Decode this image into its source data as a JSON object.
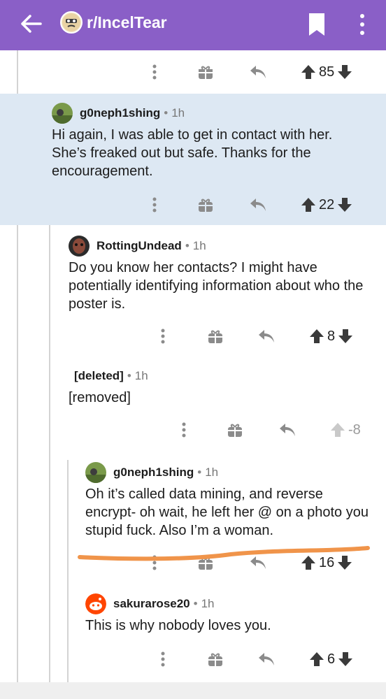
{
  "header": {
    "subreddit": "r/IncelTear"
  },
  "colors": {
    "accent": "#8a5fc7",
    "highlight": "#dde8f3",
    "annotation": "#f0944a"
  },
  "icons": [
    "back-arrow-icon",
    "subreddit-avatar-icon",
    "bookmark-icon",
    "more-vertical-icon",
    "more-dots-icon",
    "gift-icon",
    "reply-icon",
    "upvote-icon",
    "downvote-icon"
  ],
  "comments": [
    {
      "score": "85"
    },
    {
      "user": "g0neph1shing",
      "time": "1h",
      "body": "Hi again, I was able to get in contact with her. She’s freaked out but safe. Thanks for the encouragement.",
      "score": "22"
    },
    {
      "user": "RottingUndead",
      "time": "1h",
      "body": "Do you know her contacts? I might have potentially identifying information about who the poster is.",
      "score": "8"
    },
    {
      "user": "[deleted]",
      "time": "1h",
      "body": "[removed]",
      "score": "-8"
    },
    {
      "user": "g0neph1shing",
      "time": "1h",
      "body": "Oh it’s called data mining, and reverse encrypt- oh wait, he left her @ on a photo you stupid fuck. Also I’m a woman.",
      "score": "16"
    },
    {
      "user": "sakurarose20",
      "time": "1h",
      "body": "This is why nobody loves you.",
      "score": "6"
    }
  ],
  "separator": "•"
}
